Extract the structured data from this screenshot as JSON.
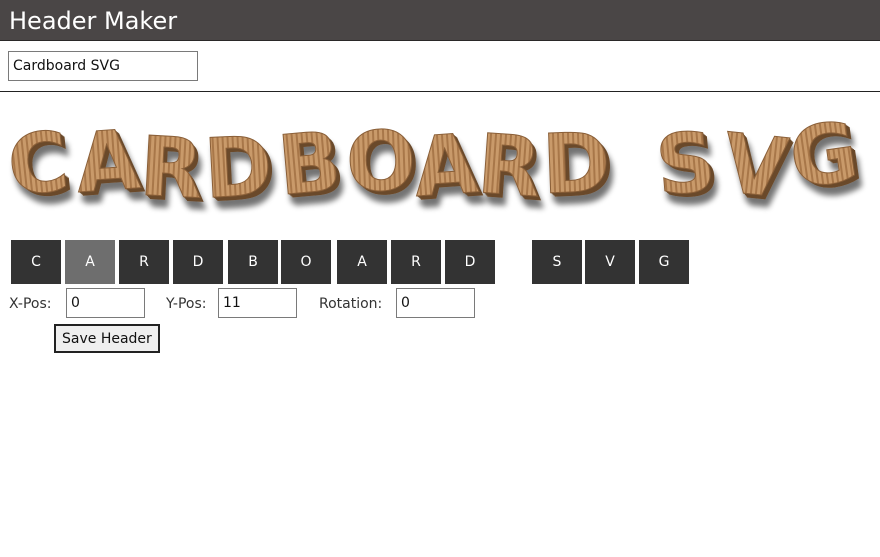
{
  "app": {
    "title": "Header Maker"
  },
  "header_text": {
    "value": "Cardboard SVG"
  },
  "preview": {
    "text": "CARDBOARD SVG",
    "letters": [
      "C",
      "A",
      "R",
      "D",
      "B",
      "O",
      "A",
      "R",
      "D",
      "S",
      "V",
      "G"
    ],
    "colors": {
      "face": "#c99a6a",
      "stripe": "#a8774a",
      "side": "#6b4a2b",
      "shadow": "#5a5a5a"
    }
  },
  "letter_buttons": [
    "C",
    "A",
    "R",
    "D",
    "B",
    "O",
    "A",
    "R",
    "D",
    "S",
    "V",
    "G"
  ],
  "selected_letter_index": 1,
  "controls": {
    "xpos_label": "X-Pos:",
    "xpos_value": "0",
    "ypos_label": "Y-Pos:",
    "ypos_value": "11",
    "rotation_label": "Rotation:",
    "rotation_value": "0"
  },
  "save_button": "Save Header",
  "colors": {
    "titlebar": "#4a4646",
    "button": "#333333",
    "button_selected": "#6e6e6e"
  }
}
